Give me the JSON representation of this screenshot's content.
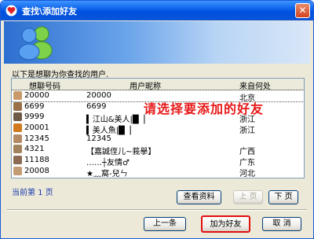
{
  "window": {
    "title": "查找\\添加好友",
    "close_glyph": "✕"
  },
  "intro_text": "以下是想聊为你查找的用户.",
  "table": {
    "columns": [
      "想聊号码",
      "用户昵称",
      "来自何处"
    ],
    "rows": [
      {
        "id": "20000",
        "nick": "20000",
        "from": "北京",
        "avatar_color": "#c89a6a"
      },
      {
        "id": "6699",
        "nick": "6699",
        "from": "",
        "avatar_color": "#9a7048"
      },
      {
        "id": "9999",
        "nick": "▍江山&美人|█▕",
        "from": "浙江",
        "avatar_color": "#6f5a48"
      },
      {
        "id": "20001",
        "nick": "▍美人魚|█▕",
        "from": "浙江",
        "avatar_color": "#d07a20"
      },
      {
        "id": "12345",
        "nick": "12345",
        "from": "",
        "avatar_color": "#b58b66"
      },
      {
        "id": "4321",
        "nick": "【嘉誠侄儿~莪擧】",
        "from": "广西",
        "avatar_color": "#a3835d"
      },
      {
        "id": "11188",
        "nick": "……┼友情♂",
        "from": "广东",
        "avatar_color": "#8d6b52"
      },
      {
        "id": "20008",
        "nick": "★﹏窩-兒ㄣ",
        "from": "河北",
        "avatar_color": "#c49c74"
      }
    ]
  },
  "hint": "请选择要添加的好友",
  "pagination": {
    "label": "当前第 1 页"
  },
  "buttons": {
    "view_profile": "查看资料",
    "prev_page": "上 页",
    "next_page": "下 页",
    "prev_step": "上一条",
    "add_friend": "加为好友",
    "cancel": "取 消"
  }
}
